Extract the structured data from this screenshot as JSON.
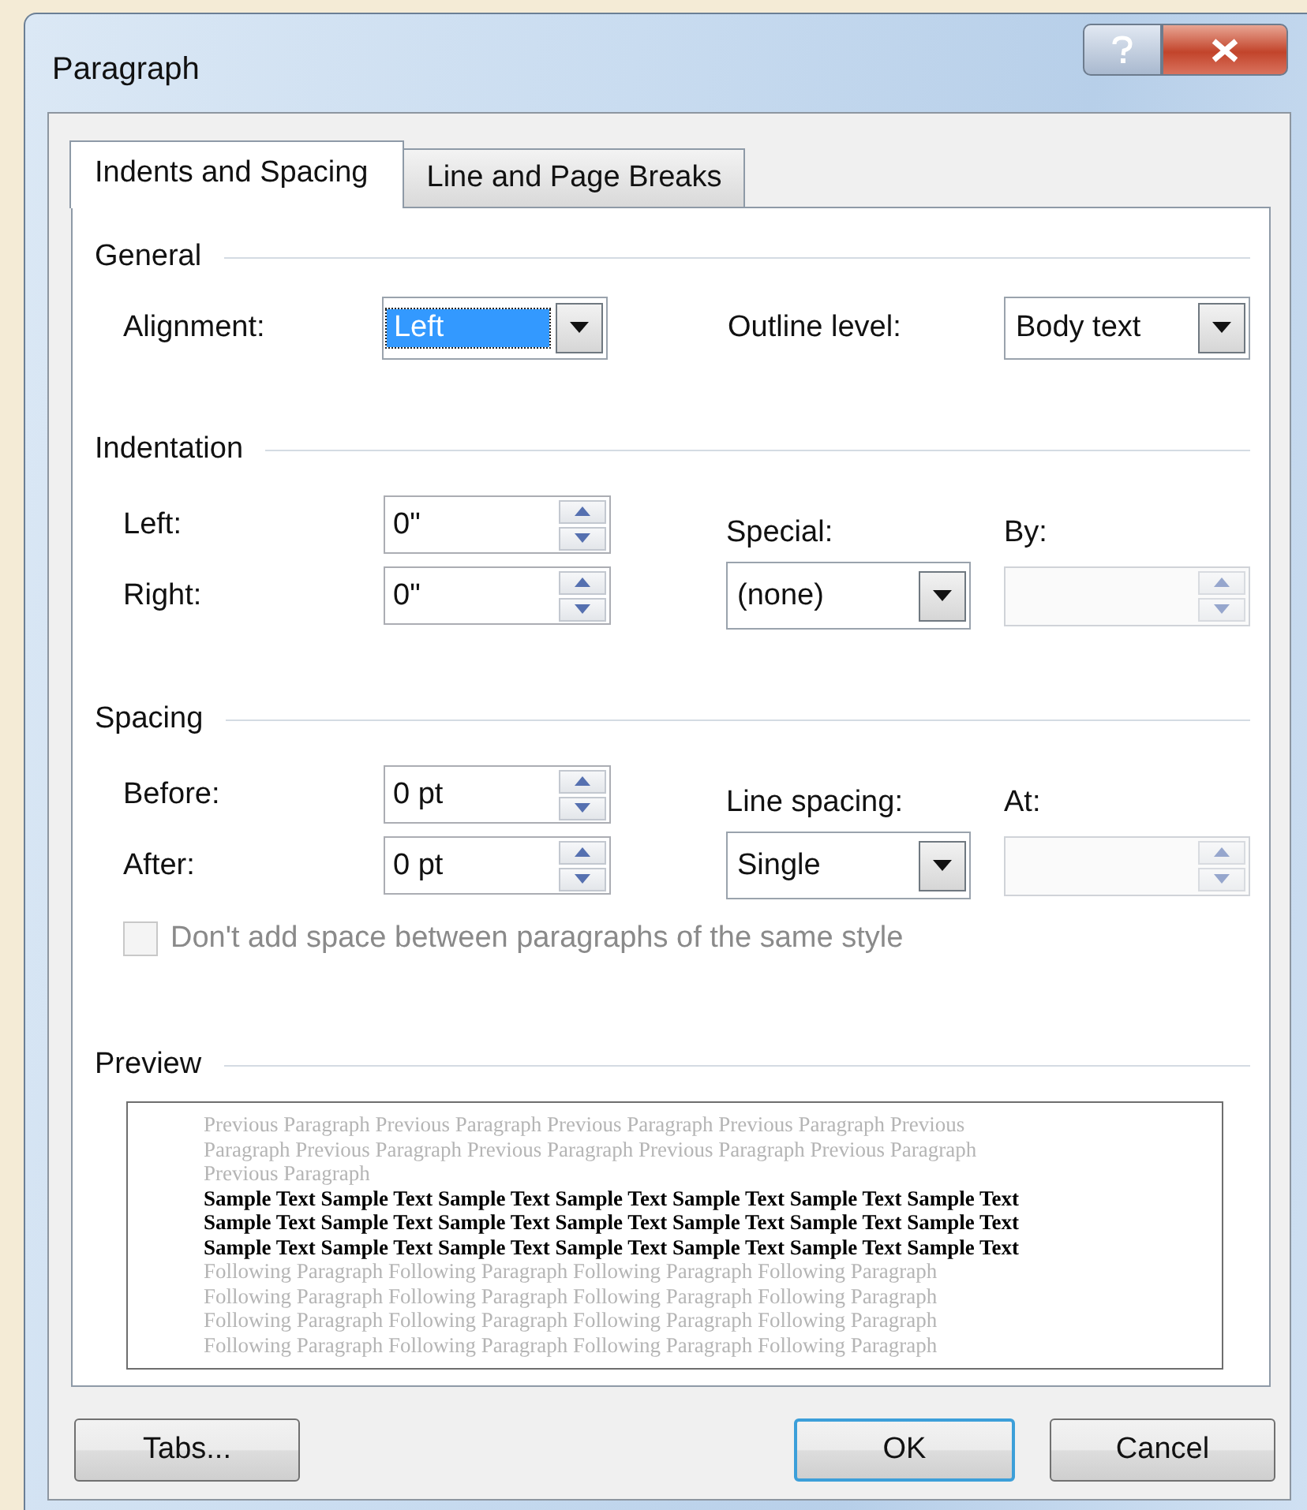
{
  "window": {
    "title": "Paragraph"
  },
  "tabs": [
    {
      "label": "Indents and Spacing",
      "selected": true
    },
    {
      "label": "Line and Page Breaks",
      "selected": false
    }
  ],
  "general": {
    "heading": "General",
    "alignment": {
      "label": "Alignment:",
      "value": "Left",
      "focused": true
    },
    "outline_level": {
      "label": "Outline level:",
      "value": "Body text",
      "focused": false
    }
  },
  "indentation": {
    "heading": "Indentation",
    "left": {
      "label": "Left:",
      "value": "0\"",
      "disabled": false
    },
    "right": {
      "label": "Right:",
      "value": "0\"",
      "disabled": false
    },
    "special": {
      "label": "Special:",
      "value": "(none)",
      "focused": false
    },
    "by": {
      "label": "By:",
      "disabled": true
    }
  },
  "spacing": {
    "heading": "Spacing",
    "before": {
      "label": "Before:",
      "value": "0 pt",
      "disabled": false
    },
    "after": {
      "label": "After:",
      "value": "0 pt",
      "disabled": false
    },
    "line_spacing": {
      "label": "Line spacing:",
      "value": "Single",
      "focused": false
    },
    "at": {
      "label": "At:",
      "disabled": true
    },
    "checkbox": {
      "label": "Don't add space between paragraphs of the same style",
      "checked": false,
      "disabled": true
    }
  },
  "preview": {
    "heading": "Preview",
    "lines": [
      {
        "kind": "previous",
        "text": "Previous Paragraph Previous Paragraph Previous Paragraph Previous Paragraph Previous"
      },
      {
        "kind": "previous",
        "text": "Paragraph Previous Paragraph Previous Paragraph Previous Paragraph Previous Paragraph"
      },
      {
        "kind": "previous",
        "text": "Previous Paragraph"
      },
      {
        "kind": "sample",
        "text": "Sample Text Sample Text Sample Text Sample Text Sample Text Sample Text Sample Text"
      },
      {
        "kind": "sample",
        "text": "Sample Text Sample Text Sample Text Sample Text Sample Text Sample Text Sample Text"
      },
      {
        "kind": "sample",
        "text": "Sample Text Sample Text Sample Text Sample Text Sample Text Sample Text Sample Text"
      },
      {
        "kind": "following",
        "text": "Following Paragraph Following Paragraph Following Paragraph Following Paragraph"
      },
      {
        "kind": "following",
        "text": "Following Paragraph Following Paragraph Following Paragraph Following Paragraph"
      },
      {
        "kind": "following",
        "text": "Following Paragraph Following Paragraph Following Paragraph Following Paragraph"
      },
      {
        "kind": "following",
        "text": "Following Paragraph Following Paragraph Following Paragraph Following Paragraph"
      }
    ]
  },
  "buttons": [
    {
      "label": "Tabs...",
      "default": false
    },
    {
      "label": "OK",
      "default": true
    },
    {
      "label": "Cancel",
      "default": false
    }
  ]
}
